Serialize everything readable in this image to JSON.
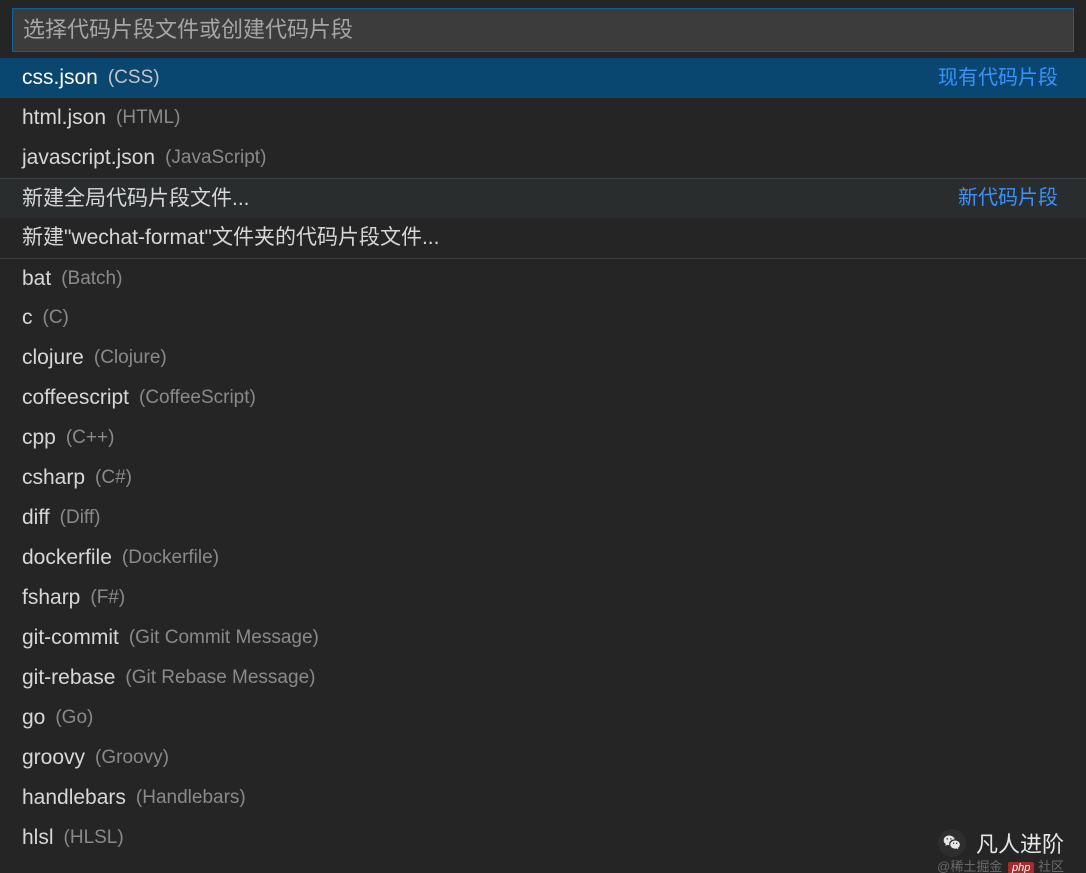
{
  "input": {
    "placeholder": "选择代码片段文件或创建代码片段",
    "value": ""
  },
  "sections": {
    "existing": "现有代码片段",
    "new": "新代码片段"
  },
  "existing_items": [
    {
      "primary": "css.json",
      "secondary": "(CSS)",
      "selected": true
    },
    {
      "primary": "html.json",
      "secondary": "(HTML)"
    },
    {
      "primary": "javascript.json",
      "secondary": "(JavaScript)"
    }
  ],
  "new_items": [
    {
      "primary": "新建全局代码片段文件...",
      "secondary": "",
      "hover": true
    },
    {
      "primary": "新建\"wechat-format\"文件夹的代码片段文件...",
      "secondary": ""
    }
  ],
  "language_items": [
    {
      "primary": "bat",
      "secondary": "(Batch)"
    },
    {
      "primary": "c",
      "secondary": "(C)"
    },
    {
      "primary": "clojure",
      "secondary": "(Clojure)"
    },
    {
      "primary": "coffeescript",
      "secondary": "(CoffeeScript)"
    },
    {
      "primary": "cpp",
      "secondary": "(C++)"
    },
    {
      "primary": "csharp",
      "secondary": "(C#)"
    },
    {
      "primary": "diff",
      "secondary": "(Diff)"
    },
    {
      "primary": "dockerfile",
      "secondary": "(Dockerfile)"
    },
    {
      "primary": "fsharp",
      "secondary": "(F#)"
    },
    {
      "primary": "git-commit",
      "secondary": "(Git Commit Message)"
    },
    {
      "primary": "git-rebase",
      "secondary": "(Git Rebase Message)"
    },
    {
      "primary": "go",
      "secondary": "(Go)"
    },
    {
      "primary": "groovy",
      "secondary": "(Groovy)"
    },
    {
      "primary": "handlebars",
      "secondary": "(Handlebars)"
    },
    {
      "primary": "hlsl",
      "secondary": "(HLSL)"
    }
  ],
  "watermark": {
    "text": "凡人进阶",
    "subtext_prefix": "@稀土掘金",
    "badge": "php",
    "subtext_suffix": "社区"
  }
}
